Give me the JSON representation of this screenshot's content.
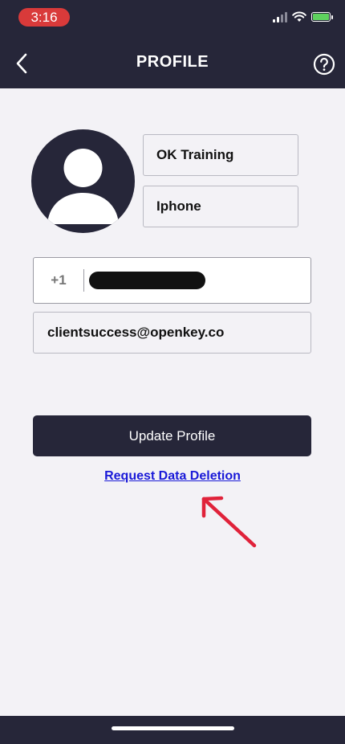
{
  "status_bar": {
    "time": "3:16",
    "icons": [
      "cellular-signal-icon",
      "wifi-icon",
      "battery-charging-icon"
    ]
  },
  "header": {
    "title": "PROFILE",
    "back_icon": "chevron-left-icon",
    "help_icon": "question-circle-icon"
  },
  "profile": {
    "avatar_icon": "user-avatar-icon",
    "first_name": "OK Training",
    "last_name": "Iphone",
    "phone_country_code": "+1",
    "email": "clientsuccess@openkey.co"
  },
  "actions": {
    "update_label": "Update Profile",
    "delete_label": "Request Data Deletion"
  },
  "annotation": {
    "arrow_color": "#e0223a"
  },
  "colors": {
    "primary_dark": "#262639",
    "background": "#f3f2f6",
    "link": "#1a1ad8",
    "time_pill": "#d93a3a"
  }
}
